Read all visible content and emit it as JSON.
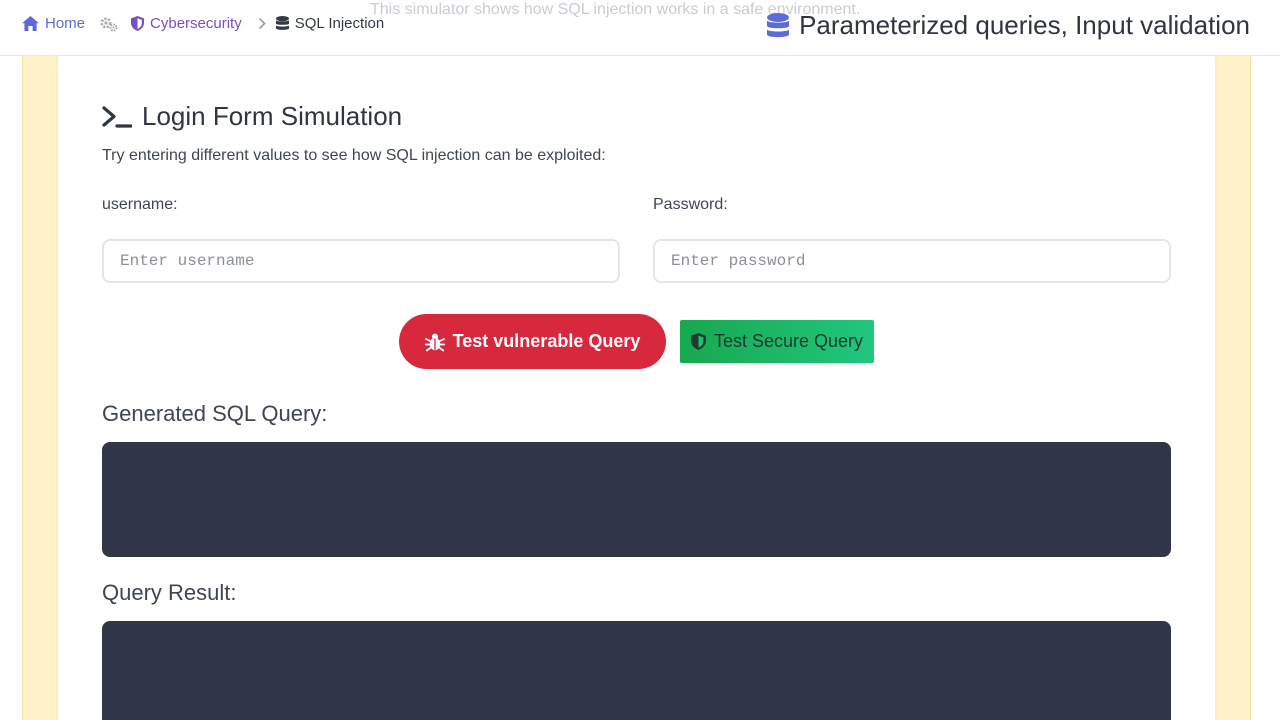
{
  "breadcrumb": {
    "home": "Home",
    "section": "Cybersecurity",
    "current": "SQL Injection"
  },
  "faded_note": "This simulator shows how SQL injection works in a safe environment.",
  "page_heading": "Parameterized queries, Input validation",
  "form": {
    "title": "Login Form Simulation",
    "description": "Try entering different values to see how SQL injection can be exploited:",
    "username_label": "username:",
    "username_placeholder": "Enter username",
    "username_value": "",
    "password_label": "Password:",
    "password_placeholder": "Enter password",
    "password_value": "",
    "vulnerable_button": "Test vulnerable Query",
    "secure_button": "Test Secure Query"
  },
  "query": {
    "generated_label": "Generated SQL Query:",
    "generated_value": "",
    "result_label": "Query Result:",
    "result_value": ""
  },
  "colors": {
    "danger": "#d8283e",
    "success": "#1ec277",
    "code_bg": "#303548",
    "backdrop": "#fff2c9",
    "link": "#5b6cd6",
    "accent_purple": "#7a4fc0"
  },
  "icons": {
    "home": "home-icon",
    "gears": "gears-icon",
    "shield": "shield-icon",
    "chevron": "chevron-right-icon",
    "database": "database-icon",
    "terminal": "terminal-icon",
    "bug": "bug-icon"
  }
}
